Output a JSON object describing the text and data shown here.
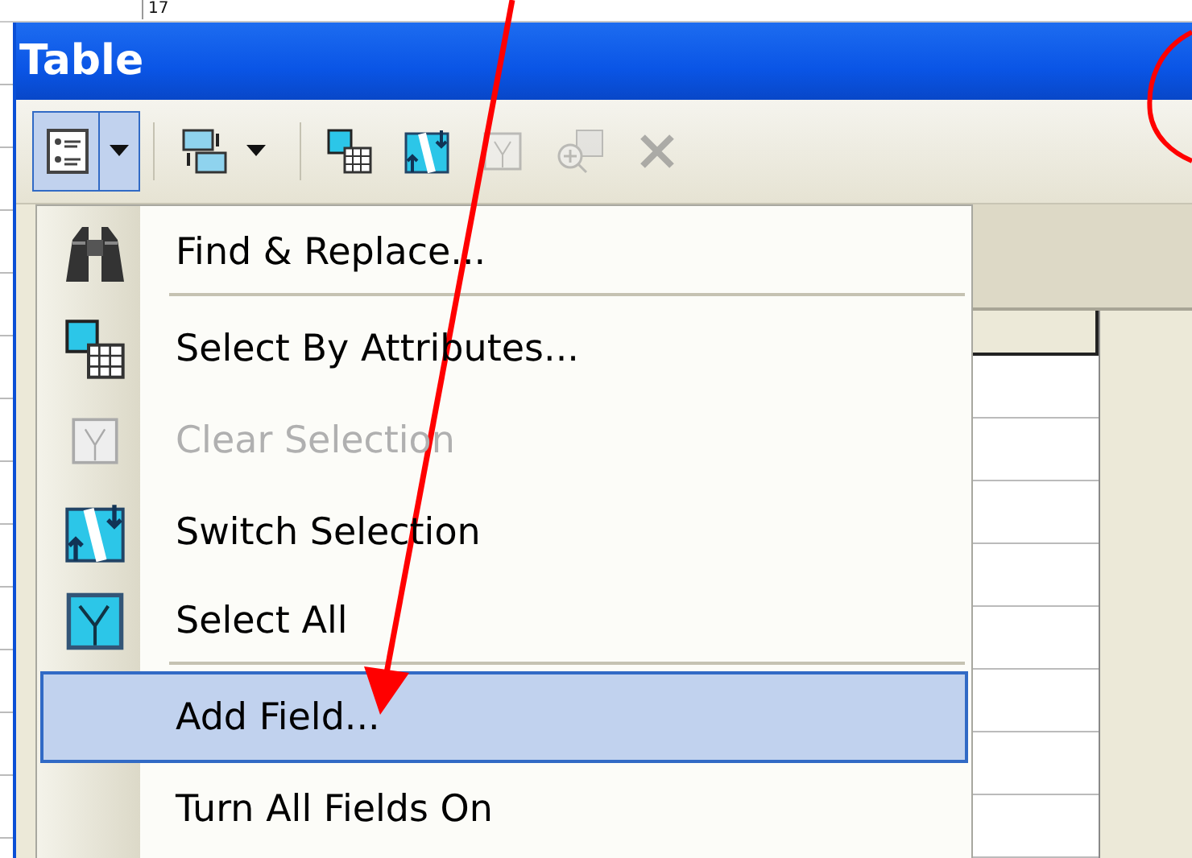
{
  "background_sheet": {
    "cell": "17"
  },
  "window": {
    "title": "Table"
  },
  "toolbar": [
    {
      "kind": "options",
      "selected": true,
      "dropdown": true,
      "disabled": false
    },
    {
      "kind": "related",
      "selected": false,
      "dropdown": true,
      "disabled": false
    },
    {
      "kind": "select-attributes",
      "selected": false,
      "dropdown": false,
      "disabled": false
    },
    {
      "kind": "switch",
      "selected": false,
      "dropdown": false,
      "disabled": false
    },
    {
      "kind": "clear",
      "selected": false,
      "dropdown": false,
      "disabled": true
    },
    {
      "kind": "zoom",
      "selected": false,
      "dropdown": false,
      "disabled": true
    },
    {
      "kind": "delete",
      "selected": false,
      "dropdown": false,
      "disabled": true
    }
  ],
  "menu": [
    {
      "kind": "binoculars",
      "label": "Find & Replace...",
      "disabled": false,
      "selected": false,
      "separator_after": true
    },
    {
      "kind": "select-attributes",
      "label": "Select By Attributes...",
      "disabled": false,
      "selected": false,
      "separator_after": false
    },
    {
      "kind": "clear",
      "label": "Clear Selection",
      "disabled": true,
      "selected": false,
      "separator_after": false
    },
    {
      "kind": "switch",
      "label": "Switch Selection",
      "disabled": false,
      "selected": false,
      "separator_after": false
    },
    {
      "kind": "select-all",
      "label": "Select All",
      "disabled": false,
      "selected": false,
      "separator_after": true
    },
    {
      "kind": "none",
      "label": "Add Field...",
      "disabled": false,
      "selected": true,
      "separator_after": false
    },
    {
      "kind": "none",
      "label": "Turn All Fields On",
      "disabled": false,
      "selected": false,
      "separator_after": false
    }
  ]
}
